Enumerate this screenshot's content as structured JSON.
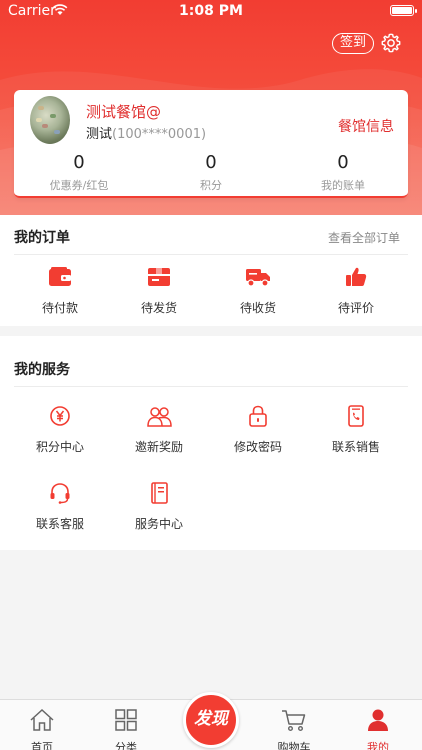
{
  "status_bar": {
    "carrier": "Carrier",
    "time": "1:08 PM"
  },
  "header": {
    "checkin_label": "签到",
    "settings_icon": "gear-icon"
  },
  "profile": {
    "shop_name": "测试餐馆@",
    "user_name": "测试",
    "phone": "(100****0001)",
    "shop_info_link": "餐馆信息",
    "stats": [
      {
        "value": "0",
        "label": "优惠券/红包"
      },
      {
        "value": "0",
        "label": "积分"
      },
      {
        "value": "0",
        "label": "我的账单"
      }
    ]
  },
  "orders": {
    "title": "我的订单",
    "view_all": "查看全部订单",
    "items": [
      {
        "label": "待付款",
        "icon": "wallet-icon"
      },
      {
        "label": "待发货",
        "icon": "package-icon"
      },
      {
        "label": "待收货",
        "icon": "truck-icon"
      },
      {
        "label": "待评价",
        "icon": "thumbs-up-icon"
      }
    ]
  },
  "services": {
    "title": "我的服务",
    "items": [
      {
        "label": "积分中心",
        "icon": "yen-icon"
      },
      {
        "label": "邀新奖励",
        "icon": "users-icon"
      },
      {
        "label": "修改密码",
        "icon": "lock-icon"
      },
      {
        "label": "联系销售",
        "icon": "phone-icon"
      },
      {
        "label": "联系客服",
        "icon": "headset-icon"
      },
      {
        "label": "服务中心",
        "icon": "book-icon"
      }
    ]
  },
  "tabbar": {
    "items": [
      {
        "label": "首页",
        "icon": "home-icon"
      },
      {
        "label": "分类",
        "icon": "grid-icon"
      },
      {
        "label": "发现",
        "icon": "discover-icon"
      },
      {
        "label": "购物车",
        "icon": "cart-icon"
      },
      {
        "label": "我的",
        "icon": "user-icon",
        "active": true
      }
    ]
  },
  "colors": {
    "accent": "#f23d32",
    "text_red": "#e02f2f",
    "background": "#f4f4f4"
  }
}
